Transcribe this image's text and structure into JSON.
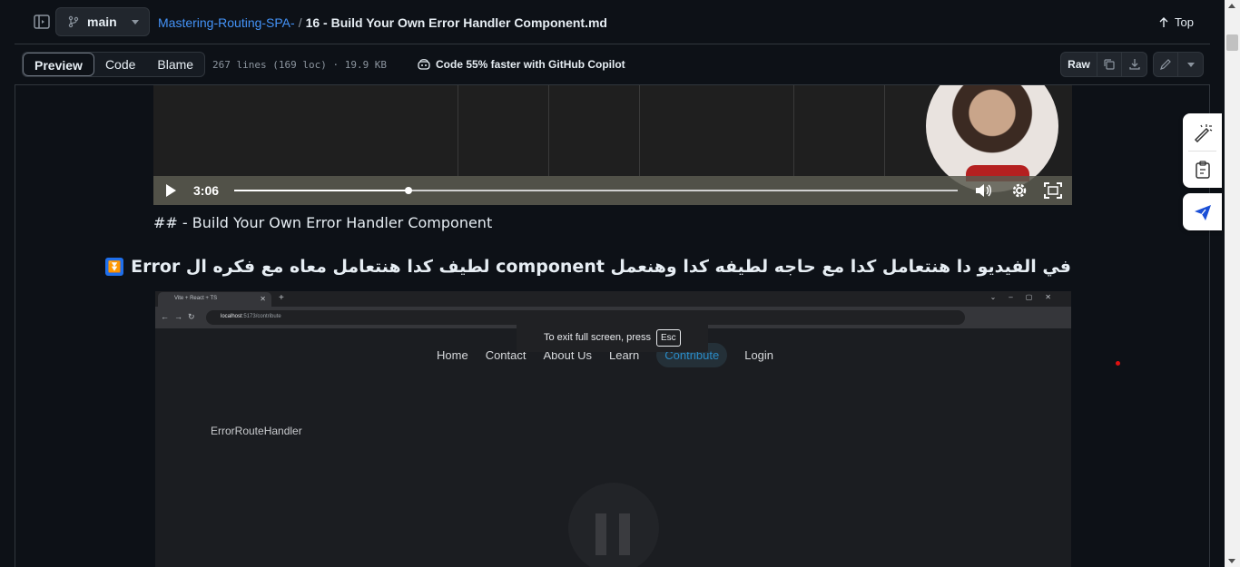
{
  "header": {
    "branch": "main",
    "repo": "Mastering-Routing-SPA-",
    "separator": "/",
    "file": "16 - Build Your Own Error Handler Component.md",
    "top_label": "Top"
  },
  "toolbar": {
    "tabs": [
      {
        "label": "Preview",
        "active": true
      },
      {
        "label": "Code",
        "active": false
      },
      {
        "label": "Blame",
        "active": false
      }
    ],
    "meta": "267 lines (169 loc) · 19.9 KB",
    "copilot": "Code 55% faster with GitHub Copilot",
    "raw_label": "Raw",
    "icons": [
      "copy-icon",
      "download-icon",
      "pencil-icon",
      "chevron-down-icon"
    ]
  },
  "video1": {
    "time": "3:06",
    "progress": 0.241
  },
  "content": {
    "md_heading": "## - Build Your Own Error Handler Component",
    "arabic_heading": "في الفيديو دا هنتعامل كدا مع حاجه لطيفه كدا وهنعمل component لطيف كدا هنتعامل معاه مع فكره ال Error",
    "badge": "⏬"
  },
  "video2": {
    "browser_tab": "Vite + React + TS",
    "url_host": "localhost",
    "url_path": ":5173/contribute",
    "nav": [
      "Home",
      "Contact",
      "About Us",
      "Learn",
      "Contribute",
      "Login"
    ],
    "active_nav": "Contribute",
    "error_text": "ErrorRouteHandler",
    "fullscreen_text": "To exit full screen, press",
    "fullscreen_key": "Esc"
  },
  "colors": {
    "link": "#4493f8",
    "background": "#0d1117",
    "accent": "#1f6feb",
    "contribute": "#2a8bc7"
  }
}
